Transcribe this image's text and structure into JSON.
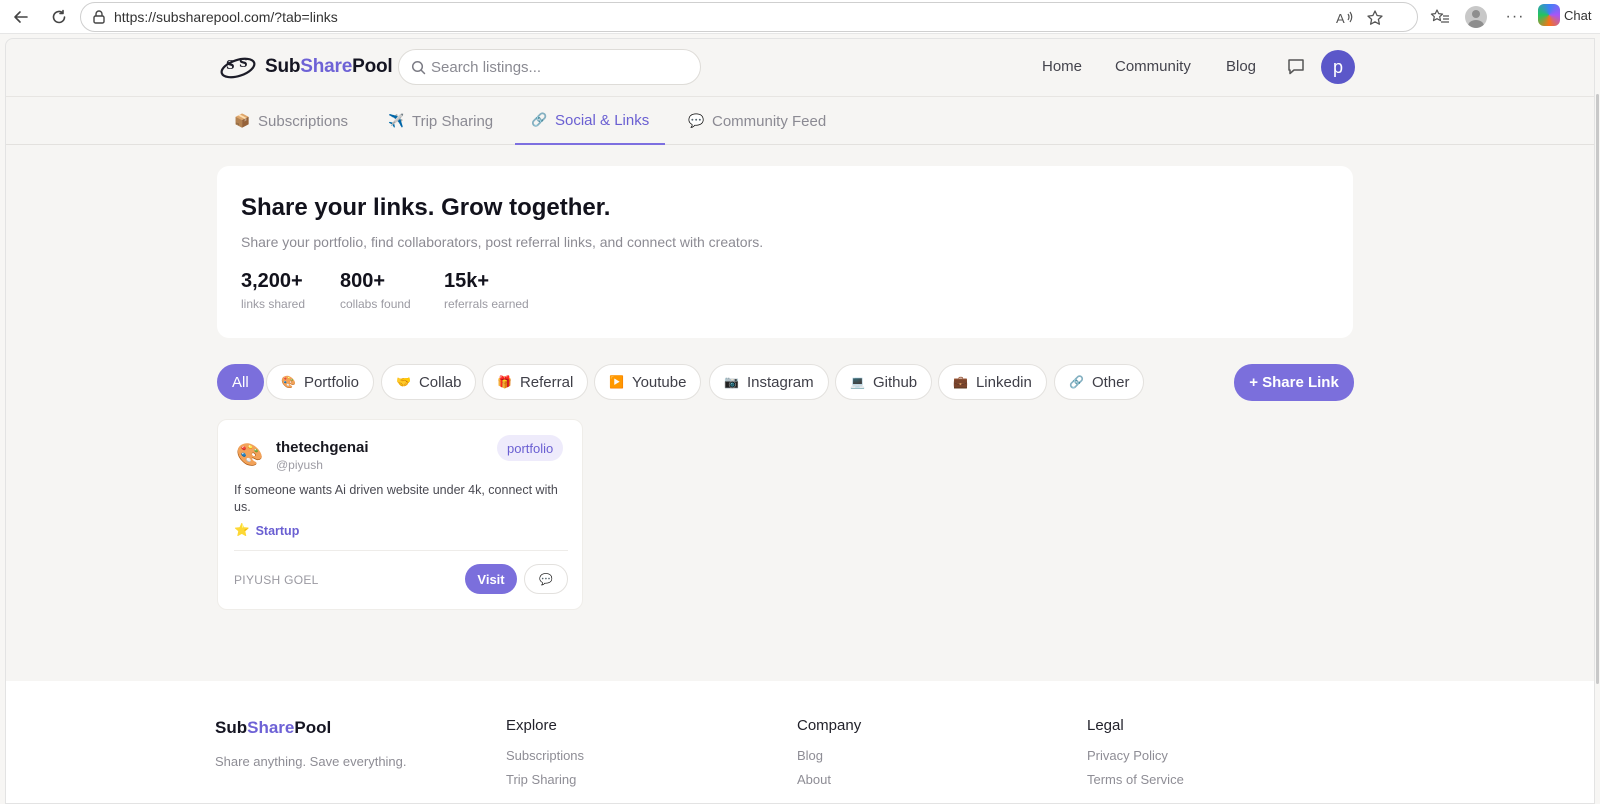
{
  "browser": {
    "url": "https://subsharepool.com/?tab=links",
    "copilot_label": "Chat"
  },
  "header": {
    "brand_prefix": "Sub",
    "brand_accent": "Share",
    "brand_suffix": "Pool",
    "search_placeholder": "Search listings...",
    "nav": [
      "Home",
      "Community",
      "Blog"
    ],
    "avatar_initial": "p"
  },
  "tabs": [
    {
      "icon": "📦",
      "label": "Subscriptions"
    },
    {
      "icon": "✈️",
      "label": "Trip Sharing"
    },
    {
      "icon": "🔗",
      "label": "Social & Links"
    },
    {
      "icon": "💬",
      "label": "Community Feed"
    }
  ],
  "active_tab": "Social & Links",
  "hero": {
    "title": "Share your links. Grow together.",
    "subtitle": "Share your portfolio, find collaborators, post referral links, and connect with creators.",
    "stats": [
      {
        "value": "3,200+",
        "label": "links shared"
      },
      {
        "value": "800+",
        "label": "collabs found"
      },
      {
        "value": "15k+",
        "label": "referrals earned"
      }
    ]
  },
  "filters": [
    {
      "icon": "",
      "label": "All"
    },
    {
      "icon": "🎨",
      "label": "Portfolio"
    },
    {
      "icon": "🤝",
      "label": "Collab"
    },
    {
      "icon": "🎁",
      "label": "Referral"
    },
    {
      "icon": "▶️",
      "label": "Youtube"
    },
    {
      "icon": "📷",
      "label": "Instagram"
    },
    {
      "icon": "💻",
      "label": "Github"
    },
    {
      "icon": "💼",
      "label": "Linkedin"
    },
    {
      "icon": "🔗",
      "label": "Other"
    }
  ],
  "share_button": "+ Share Link",
  "card": {
    "icon": "🎨",
    "name": "thetechgenai",
    "handle": "@piyush",
    "badge": "portfolio",
    "description": "If someone wants Ai driven website under 4k, connect with us.",
    "tag_icon": "⭐",
    "tag": "Startup",
    "owner": "PIYUSH GOEL",
    "visit_label": "Visit",
    "comment_icon": "💬"
  },
  "footer": {
    "brand_prefix": "Sub",
    "brand_accent": "Share",
    "brand_suffix": "Pool",
    "tagline": "Share anything. Save everything.",
    "columns": [
      {
        "heading": "Explore",
        "links": [
          "Subscriptions",
          "Trip Sharing"
        ]
      },
      {
        "heading": "Company",
        "links": [
          "Blog",
          "About"
        ]
      },
      {
        "heading": "Legal",
        "links": [
          "Privacy Policy",
          "Terms of Service"
        ]
      }
    ]
  },
  "colors": {
    "accent": "#7b6fdc",
    "accent_text": "#6a5fd2",
    "avatar": "#5b57c9",
    "background": "#f6f5f3"
  }
}
